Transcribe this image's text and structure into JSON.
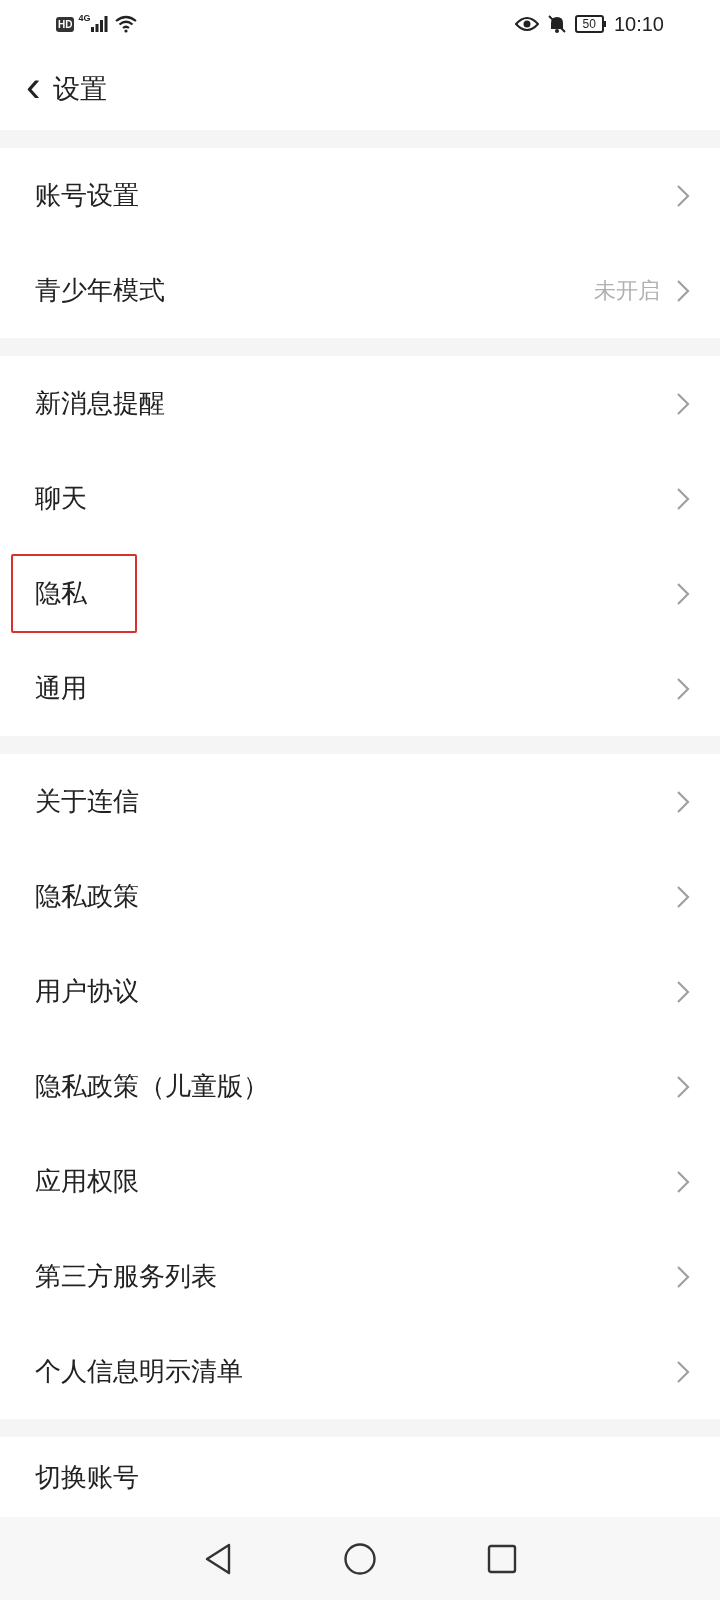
{
  "status_bar": {
    "hd": "HD",
    "network": "4G",
    "battery": "50",
    "time": "10:10"
  },
  "header": {
    "back": "‹",
    "title": "设置"
  },
  "groups": [
    {
      "items": [
        {
          "label": "账号设置",
          "highlighted": false
        },
        {
          "label": "青少年模式",
          "value": "未开启",
          "highlighted": false
        }
      ]
    },
    {
      "items": [
        {
          "label": "新消息提醒",
          "highlighted": false
        },
        {
          "label": "聊天",
          "highlighted": false
        },
        {
          "label": "隐私",
          "highlighted": true
        },
        {
          "label": "通用",
          "highlighted": false
        }
      ]
    },
    {
      "items": [
        {
          "label": "关于连信",
          "highlighted": false
        },
        {
          "label": "隐私政策",
          "highlighted": false
        },
        {
          "label": "用户协议",
          "highlighted": false
        },
        {
          "label": "隐私政策（儿童版）",
          "highlighted": false
        },
        {
          "label": "应用权限",
          "highlighted": false
        },
        {
          "label": "第三方服务列表",
          "highlighted": false
        },
        {
          "label": "个人信息明示清单",
          "highlighted": false
        }
      ]
    },
    {
      "items": [
        {
          "label": "切换账号",
          "highlighted": false
        }
      ],
      "cut": true
    }
  ]
}
